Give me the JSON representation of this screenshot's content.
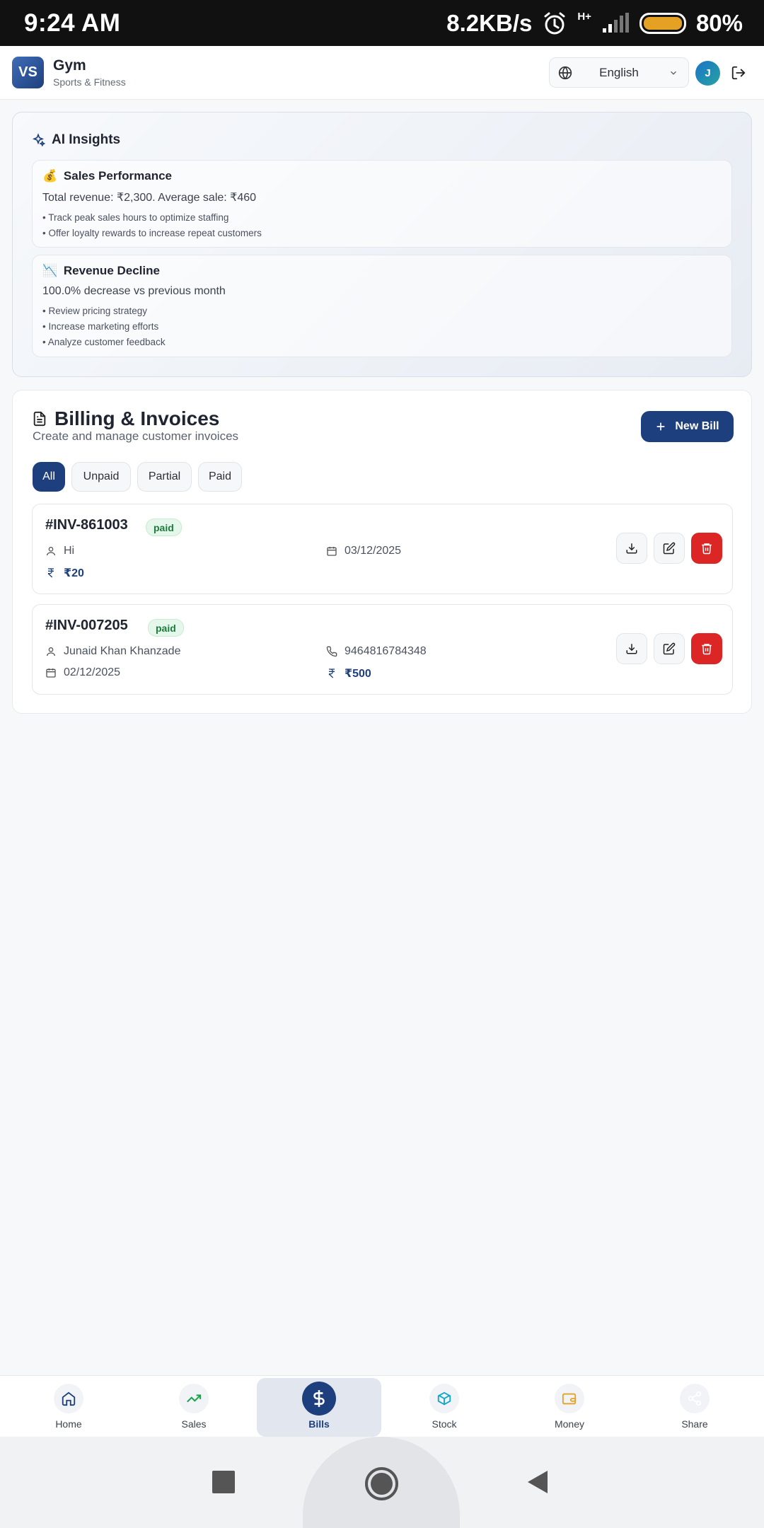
{
  "status_bar": {
    "time": "9:24 AM",
    "speed": "8.2KB/s",
    "network": "H+",
    "battery": "80%"
  },
  "header": {
    "logo": "VS",
    "title": "Gym",
    "subtitle": "Sports & Fitness",
    "language": "English",
    "avatar_initial": "J"
  },
  "ai_insights": {
    "title": "AI Insights",
    "cards": [
      {
        "emoji": "💰",
        "title": "Sales Performance",
        "text": "Total revenue: ₹2,300. Average sale: ₹460",
        "tips": [
          "• Track peak sales hours to optimize staffing",
          "• Offer loyalty rewards to increase repeat customers"
        ]
      },
      {
        "emoji": "📉",
        "title": "Revenue Decline",
        "text": "100.0% decrease vs previous month",
        "tips": [
          "• Review pricing strategy",
          "• Increase marketing efforts",
          "• Analyze customer feedback"
        ]
      }
    ]
  },
  "billing": {
    "title": "Billing & Invoices",
    "subtitle": "Create and manage customer invoices",
    "new_bill_label": "New Bill",
    "tabs": [
      "All",
      "Unpaid",
      "Partial",
      "Paid"
    ],
    "active_tab": "All",
    "invoices": [
      {
        "id": "#INV-861003",
        "status": "paid",
        "customer": "Hi",
        "date": "03/12/2025",
        "amount": "₹20"
      },
      {
        "id": "#INV-007205",
        "status": "paid",
        "customer": "Junaid Khan Khanzade",
        "phone": "9464816784348",
        "date": "02/12/2025",
        "amount": "₹500"
      }
    ]
  },
  "bottom_nav": {
    "items": [
      "Home",
      "Sales",
      "Bills",
      "Stock",
      "Money",
      "Share"
    ],
    "active": "Bills"
  },
  "colors": {
    "primary": "#1e3f7e",
    "danger": "#dc2626",
    "paid_badge": "#1d7c3d"
  }
}
